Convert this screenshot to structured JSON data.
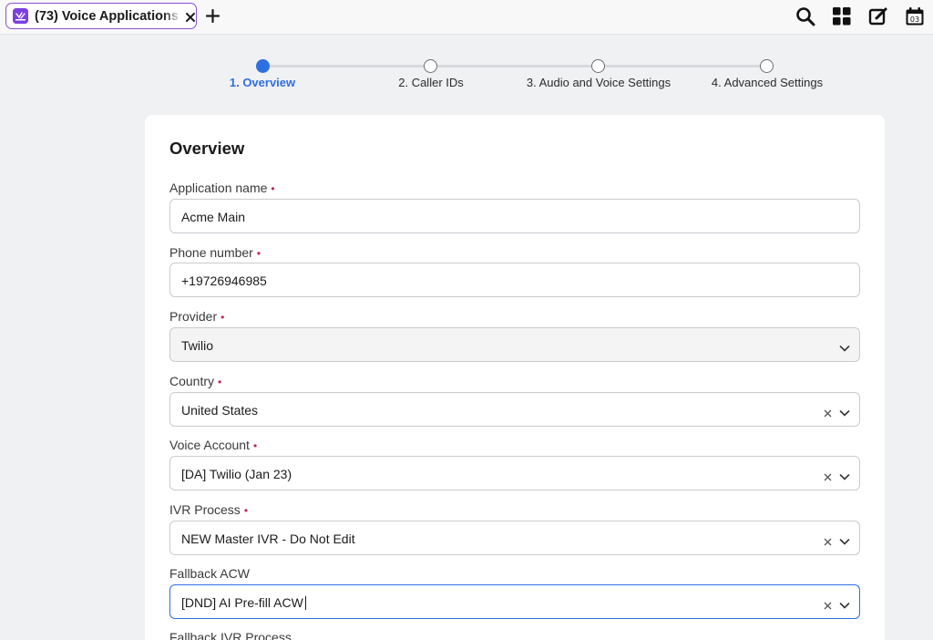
{
  "tab": {
    "title": "(73) Voice Applications",
    "icon": "voice-app-icon",
    "close_icon": "close-icon",
    "new_tab_icon": "plus-icon"
  },
  "toolbar": {
    "icons": [
      "search-icon",
      "apps-grid-icon",
      "compose-icon",
      "calendar-icon"
    ],
    "calendar_day": "03"
  },
  "stepper": {
    "steps": [
      {
        "label": "1. Overview",
        "active": true
      },
      {
        "label": "2. Caller IDs",
        "active": false
      },
      {
        "label": "3. Audio and Voice Settings",
        "active": false
      },
      {
        "label": "4. Advanced Settings",
        "active": false
      }
    ]
  },
  "form": {
    "title": "Overview",
    "required_marker": "•",
    "fields": [
      {
        "label": "Application name",
        "required": true,
        "value": "Acme Main",
        "type": "text"
      },
      {
        "label": "Phone number",
        "required": true,
        "value": "+19726946985",
        "type": "text"
      },
      {
        "label": "Provider",
        "required": true,
        "value": "Twilio",
        "type": "select-disabled"
      },
      {
        "label": "Country",
        "required": true,
        "value": "United States",
        "type": "select"
      },
      {
        "label": "Voice Account",
        "required": true,
        "value": "[DA] Twilio (Jan 23)",
        "type": "select"
      },
      {
        "label": "IVR Process",
        "required": true,
        "value": "NEW Master IVR - Do Not Edit",
        "type": "select"
      },
      {
        "label": "Fallback ACW",
        "required": false,
        "value": "[DND] AI Pre-fill ACW",
        "type": "select-focused"
      },
      {
        "label": "Fallback IVR Process",
        "required": false,
        "value": "",
        "type": "select"
      }
    ]
  },
  "colors": {
    "accent": "#2f6fe4",
    "tab_border": "#8a4fd6",
    "required": "#c2224d",
    "background": "#f0f1f3"
  }
}
